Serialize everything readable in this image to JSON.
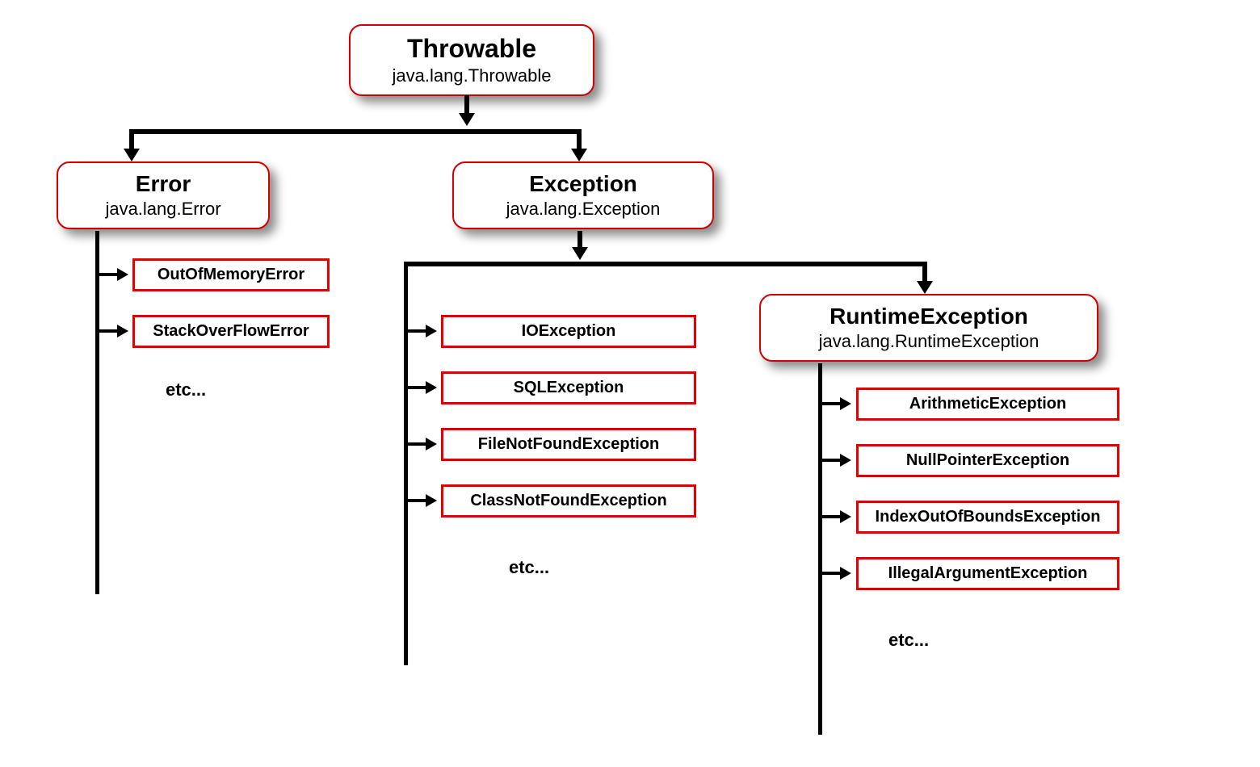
{
  "root": {
    "title": "Throwable",
    "qualified": "java.lang.Throwable"
  },
  "error": {
    "title": "Error",
    "qualified": "java.lang.Error",
    "children": [
      "OutOfMemoryError",
      "StackOverFlowError"
    ],
    "etc": "etc..."
  },
  "exception": {
    "title": "Exception",
    "qualified": "java.lang.Exception",
    "children": [
      "IOException",
      "SQLException",
      "FileNotFoundException",
      "ClassNotFoundException"
    ],
    "etc": "etc..."
  },
  "runtime": {
    "title": "RuntimeException",
    "qualified": "java.lang.RuntimeException",
    "children": [
      "ArithmeticException",
      "NullPointerException",
      "IndexOutOfBoundsException",
      "IllegalArgumentException"
    ],
    "etc": "etc..."
  }
}
